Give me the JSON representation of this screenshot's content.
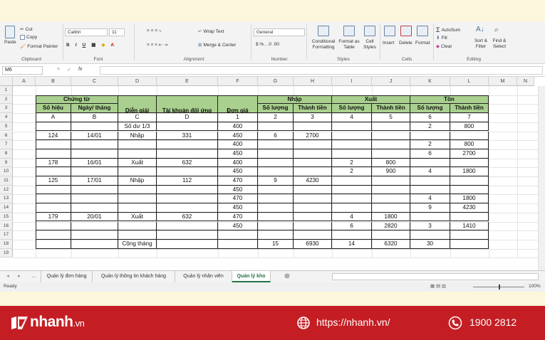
{
  "ribbon": {
    "clipboard": {
      "paste": "Paste",
      "cut": "Cut",
      "copy": "Copy",
      "format_painter": "Format Painter",
      "label": "Clipboard"
    },
    "font": {
      "name": "Calibri",
      "size": "11",
      "label": "Font"
    },
    "alignment": {
      "wrap": "Wrap Text",
      "merge": "Merge & Center",
      "label": "Alignment"
    },
    "number": {
      "format": "General",
      "label": "Number"
    },
    "styles": {
      "conditional": "Conditional Formatting",
      "format_table": "Format as Table",
      "cell_styles": "Cell Styles",
      "label": "Styles"
    },
    "cells": {
      "insert": "Insert",
      "delete": "Delete",
      "format": "Format",
      "label": "Cells"
    },
    "editing": {
      "autosum": "AutoSum",
      "fill": "Fill",
      "clear": "Clear",
      "sort": "Sort & Filter",
      "find": "Find & Select",
      "label": "Editing"
    }
  },
  "formula_bar": {
    "name_box": "M6",
    "fx": "fx",
    "cancel": "×",
    "enter": "✓"
  },
  "columns": [
    "A",
    "B",
    "C",
    "D",
    "E",
    "F",
    "G",
    "H",
    "I",
    "J",
    "K",
    "L",
    "M",
    "N"
  ],
  "rows": [
    "1",
    "2",
    "3",
    "4",
    "5",
    "6",
    "7",
    "8",
    "9",
    "10",
    "11",
    "12",
    "13",
    "14",
    "15",
    "16",
    "17",
    "18",
    "19"
  ],
  "header": {
    "chung_tu": "Chứng từ",
    "so_hieu": "Số hiệu",
    "ngay_thang": "Ngày/ tháng",
    "dien_giai": "Diễn giải",
    "tk_doi_ung": "Tài khoản đối ứng",
    "don_gia": "Đơn giá",
    "nhap": "Nhập",
    "xuat": "Xuất",
    "ton": "Tồn",
    "so_luong": "Số lượng",
    "thanh_tien": "Thành tiền"
  },
  "table_rows": [
    [
      "A",
      "B",
      "C",
      "D",
      "1",
      "2",
      "3",
      "4",
      "5",
      "6",
      "7"
    ],
    [
      "",
      "",
      "Số dư 1/3",
      "",
      "400",
      "",
      "",
      "",
      "",
      "2",
      "800"
    ],
    [
      "124",
      "14/01",
      "Nhập",
      "331",
      "450",
      "6",
      "2700",
      "",
      "",
      "",
      ""
    ],
    [
      "",
      "",
      "",
      "",
      "400",
      "",
      "",
      "",
      "",
      "2",
      "800"
    ],
    [
      "",
      "",
      "",
      "",
      "450",
      "",
      "",
      "",
      "",
      "6",
      "2700"
    ],
    [
      "178",
      "16/01",
      "Xuất",
      "632",
      "400",
      "",
      "",
      "2",
      "800",
      "",
      ""
    ],
    [
      "",
      "",
      "",
      "",
      "450",
      "",
      "",
      "2",
      "900",
      "4",
      "1800"
    ],
    [
      "125",
      "17/01",
      "Nhập",
      "112",
      "470",
      "9",
      "4230",
      "",
      "",
      "",
      ""
    ],
    [
      "",
      "",
      "",
      "",
      "450",
      "",
      "",
      "",
      "",
      "",
      ""
    ],
    [
      "",
      "",
      "",
      "",
      "470",
      "",
      "",
      "",
      "",
      "4",
      "1800"
    ],
    [
      "",
      "",
      "",
      "",
      "450",
      "",
      "",
      "",
      "",
      "9",
      "4230"
    ],
    [
      "179",
      "20/01",
      "Xuất",
      "632",
      "470",
      "",
      "",
      "4",
      "1800",
      "",
      ""
    ],
    [
      "",
      "",
      "",
      "",
      "450",
      "",
      "",
      "6",
      "2820",
      "3",
      "1410"
    ],
    [
      "",
      "",
      "",
      "",
      "",
      "",
      "",
      "",
      "",
      "",
      ""
    ],
    [
      "",
      "",
      "Cộng tháng",
      "",
      "",
      "15",
      "6930",
      "14",
      "6320",
      "30",
      ""
    ]
  ],
  "sheet_tabs": [
    "...",
    "Quản lý đơn hàng",
    "Quản lý thông tin khách hàng",
    "Quản lý nhân viên",
    "Quản lý kho"
  ],
  "status": {
    "ready": "Ready",
    "zoom": "100%"
  },
  "footer": {
    "brand": "nhanh",
    "tld": ".vn",
    "url": "https://nhanh.vn/",
    "phone": "1900 2812"
  },
  "colors": {
    "header_green": "#a9d08e",
    "footer_red": "#c41e24",
    "excel_green": "#217346"
  }
}
